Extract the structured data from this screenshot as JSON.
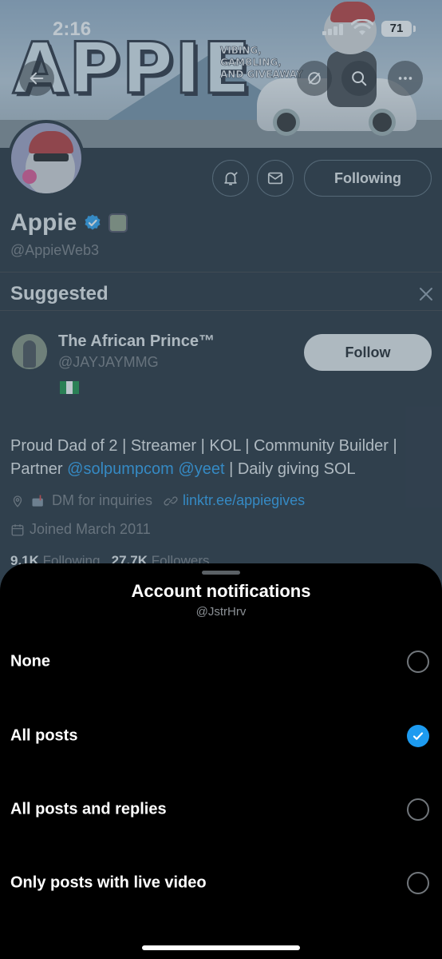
{
  "status_bar": {
    "time": "2:16",
    "battery": "71"
  },
  "banner": {
    "brand_text": "APPIE",
    "tagline": [
      "VIBING,",
      "GAMBLING,",
      "AND GIVEAWAY"
    ]
  },
  "header": {
    "icons": [
      "back-arrow-icon",
      "search-icon",
      "more-icon"
    ]
  },
  "profile": {
    "name": "Appie",
    "handle": "@AppieWeb3",
    "following_button": "Following",
    "bio_text": "Proud Dad of 2 | Streamer | KOL | Community Builder | Partner",
    "bio_mention_1": "@solpumpcom",
    "bio_mention_2": "@yeet",
    "bio_tail": "| Daily giving SOL",
    "location": "DM for inquiries",
    "link": "linktr.ee/appiegives",
    "joined": "Joined March 2011",
    "following_count": "9.1K",
    "following_label": "Following",
    "followers_count": "27.7K",
    "followers_label": "Followers"
  },
  "suggested": {
    "heading": "Suggested",
    "user": {
      "name": "The African Prince™",
      "handle": "@JAYJAYMMG",
      "follow_label": "Follow"
    }
  },
  "sheet": {
    "title": "Account notifications",
    "subtitle": "@JstrHrv",
    "options": [
      {
        "label": "None",
        "selected": false
      },
      {
        "label": "All posts",
        "selected": true
      },
      {
        "label": "All posts and replies",
        "selected": false
      },
      {
        "label": "Only posts with live video",
        "selected": false
      }
    ]
  },
  "colors": {
    "accent": "#1d9bf0",
    "sheet_bg": "#000000",
    "profile_bg": "#15202b"
  }
}
